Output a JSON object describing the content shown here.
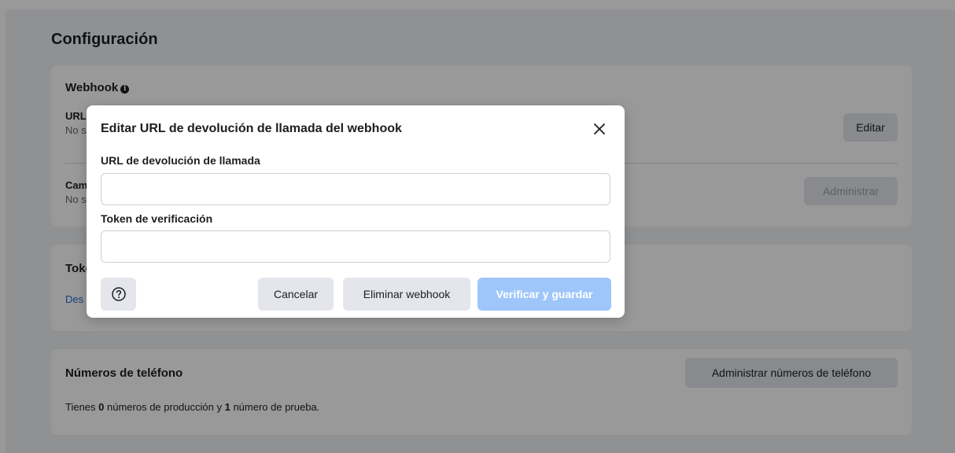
{
  "page": {
    "title": "Configuración",
    "colors": {
      "background": "#f0f2f5",
      "card": "#ffffff",
      "link": "#216fdb",
      "primary_disabled": "#9ec6fa"
    }
  },
  "webhook_card": {
    "title": "Webhook",
    "info_icon": "info-circle-icon",
    "url_row": {
      "label": "URL",
      "value": "No se",
      "button": "Editar"
    },
    "fields_row": {
      "label": "Campos",
      "value": "No se",
      "button": "Administrar"
    }
  },
  "token_card": {
    "title": "Token",
    "link": "Des"
  },
  "phones_card": {
    "title": "Números de teléfono",
    "button": "Administrar números de teléfono",
    "text_prefix": "Tienes ",
    "production_count": "0",
    "text_middle": " números de producción y ",
    "test_count": "1",
    "text_suffix": " número de prueba."
  },
  "modal": {
    "title": "Editar URL de devolución de llamada del webhook",
    "close_icon": "close-icon",
    "callback_url": {
      "label": "URL de devolución de llamada",
      "value": "",
      "placeholder": ""
    },
    "verify_token": {
      "label": "Token de verificación",
      "value": "",
      "placeholder": ""
    },
    "help_icon": "question-circle-icon",
    "cancel_label": "Cancelar",
    "delete_label": "Eliminar webhook",
    "save_label": "Verificar y guardar"
  }
}
